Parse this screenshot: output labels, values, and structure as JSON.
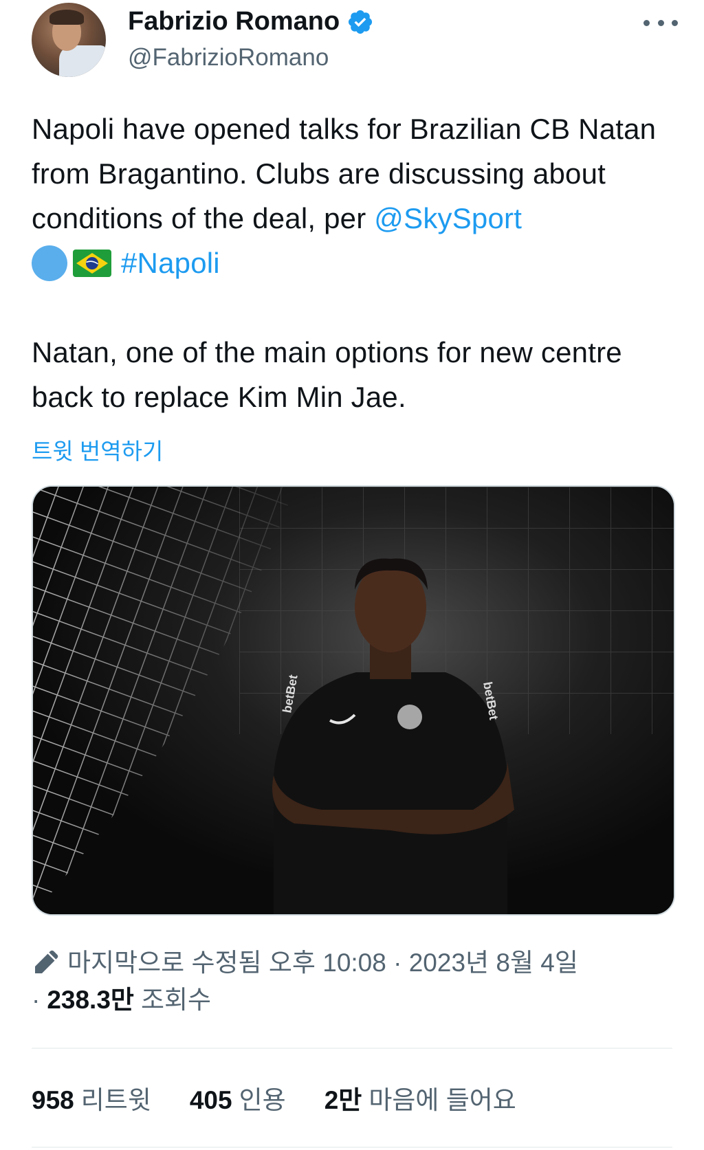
{
  "author": {
    "display_name": "Fabrizio Romano",
    "handle": "@FabrizioRomano"
  },
  "tweet": {
    "text_part1": "Napoli have opened talks for Brazilian CB Natan from Bragantino. Clubs are discussing about conditions of the deal, per ",
    "mention": "@SkySport",
    "hashtag": "#Napoli",
    "text_part2": "Natan, one of the main options for new centre back to replace Kim Min Jae."
  },
  "translate_label": "트윗 번역하기",
  "media": {
    "jersey_sponsor": "betBet"
  },
  "meta": {
    "edited_label": "마지막으로 수정됨",
    "time": "오후 10:08",
    "separator": "·",
    "date": "2023년 8월 4일",
    "views_count": "238.3만",
    "views_label": "조회수"
  },
  "stats": {
    "retweets_count": "958",
    "retweets_label": "리트윗",
    "quotes_count": "405",
    "quotes_label": "인용",
    "likes_count": "2만",
    "likes_label": "마음에 들어요"
  },
  "colors": {
    "link": "#1d9bf0",
    "secondary_text": "#536471",
    "primary_text": "#0f1419",
    "verified_badge": "#1d9bf0"
  }
}
